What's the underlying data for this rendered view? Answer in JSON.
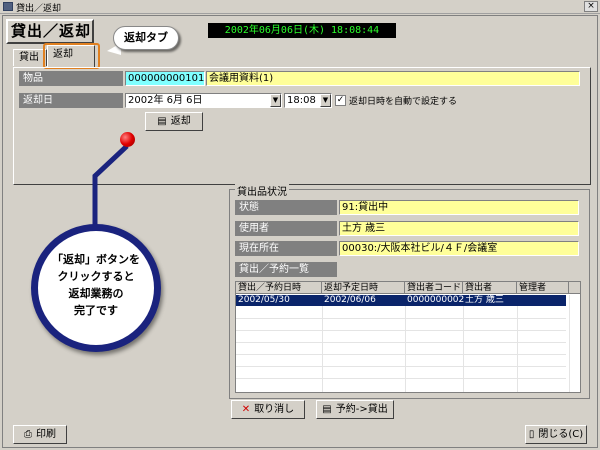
{
  "window": {
    "title": "貸出／返却",
    "close_glyph": "×"
  },
  "header": {
    "big_title": "貸出／返却",
    "clock": "2002年06月06日(木) 18:08:44"
  },
  "callouts": {
    "tab_label": "返却タブ",
    "bubble_lines": [
      "「返却」ボタンを",
      "クリックすると",
      "返却業務の",
      "完了です"
    ]
  },
  "tabs": [
    {
      "label": "貸出"
    },
    {
      "label": "返却"
    }
  ],
  "return_form": {
    "item_label": "物品",
    "item_code": "000000000101",
    "item_name": "会議用資料(1)",
    "date_label": "返却日",
    "date_value": "2002年  6月  6日",
    "time_value": "18:08",
    "auto_label": "返却日時を自動で設定する",
    "auto_checked": true,
    "return_button": "返却"
  },
  "status": {
    "group_title": "貸出品状況",
    "state_label": "状態",
    "state_value": "91:貸出中",
    "user_label": "使用者",
    "user_value": "土方  歳三",
    "location_label": "現在所在",
    "location_value": "00030:/大阪本社ビル/４Ｆ/会議室",
    "list_label": "貸出／予約一覧",
    "columns": [
      "貸出／予約日時",
      "返却予定日時",
      "貸出者コード",
      "貸出者",
      "管理者"
    ],
    "rows": [
      [
        "2002/05/30",
        "2002/06/06",
        "0000000002",
        "土方  歳三",
        ""
      ]
    ]
  },
  "actions": {
    "cancel": "取り消し",
    "reserve_to_lend": "予約->貸出",
    "print": "印刷",
    "close": "閉じる(C)"
  },
  "colors": {
    "selected_row": "#0a246a",
    "clock_text": "#2cff2c",
    "callout_border": "#1a237e",
    "tab_highlight": "#e08020"
  }
}
